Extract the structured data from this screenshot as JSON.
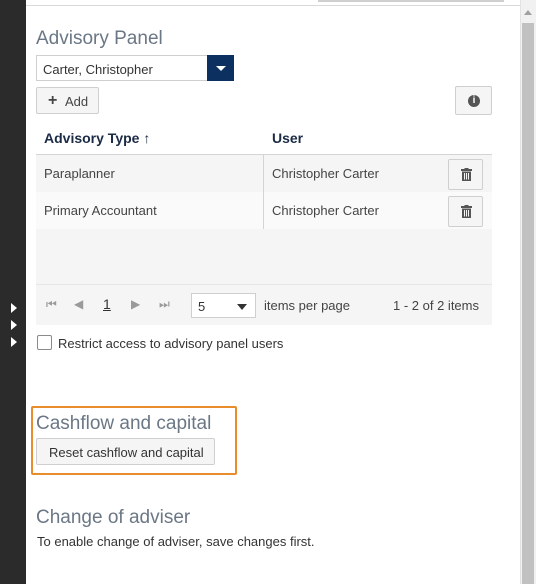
{
  "advisory_panel": {
    "title": "Advisory Panel",
    "selected_adviser": "Carter, Christopher",
    "add_label": "Add",
    "grid": {
      "columns": [
        "Advisory Type ↑",
        "User"
      ],
      "rows": [
        {
          "type": "Paraplanner",
          "user": "Christopher Carter"
        },
        {
          "type": "Primary Accountant",
          "user": "Christopher Carter"
        }
      ]
    },
    "pager": {
      "current_page": "1",
      "page_size": "5",
      "per_page_label": "items per page",
      "range_label": "1 - 2 of 2 items"
    },
    "restrict_label": "Restrict access to advisory panel users",
    "restrict_checked": false
  },
  "cashflow": {
    "title": "Cashflow and capital",
    "reset_label": "Reset cashflow and capital"
  },
  "change_adviser": {
    "title": "Change of adviser",
    "note": "To enable change of adviser, save changes first."
  },
  "colors": {
    "accent": "#0c3060",
    "highlight": "#e98d2c",
    "rail": "#2b2b2b"
  }
}
